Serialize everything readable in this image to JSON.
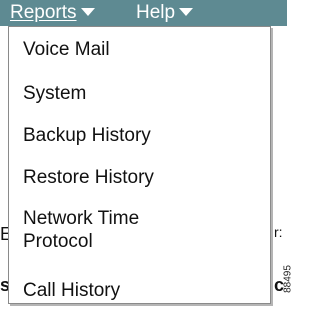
{
  "menubar": {
    "reports_label": "Reports",
    "help_label": "Help"
  },
  "dropdown": {
    "items": [
      "Voice Mail",
      "System",
      "Backup History",
      "Restore History",
      "Network Time\nProtocol",
      "Call History"
    ]
  },
  "background": {
    "left_fragment_1": "E",
    "right_fragment_1": "r:",
    "left_fragment_2": "s",
    "right_fragment_2": "c"
  },
  "figure_id": "88495",
  "colors": {
    "menubar": "#5e8a92",
    "menubar_text": "#ffffff",
    "dropdown_bg": "#ffffff",
    "dropdown_border": "#8a8a8a"
  }
}
